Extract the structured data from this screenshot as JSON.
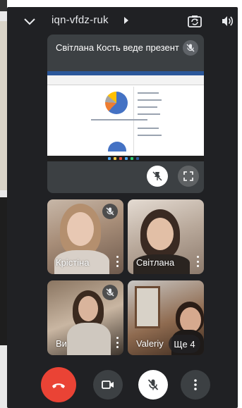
{
  "header": {
    "meeting_code": "iqn-vfdz-ruk",
    "icons": [
      "chevron-down-icon",
      "meeting-details-arrow-icon",
      "switch-camera-icon",
      "speaker-icon"
    ]
  },
  "presentation": {
    "title": "Світлана Кость веде презента",
    "mic_status": "muted"
  },
  "participants": [
    {
      "name": "Крістіна",
      "mic_status": "muted"
    },
    {
      "name": "Світлана",
      "mic_status": "on"
    },
    {
      "name": "Ви",
      "mic_status": "muted"
    },
    {
      "name": "Valeriy",
      "mic_status": "on"
    }
  ],
  "more_participants_label": "Ще 4",
  "controls": {
    "icons": [
      "end-call-icon",
      "camera-icon",
      "mic-off-icon",
      "more-options-icon"
    ],
    "colors": {
      "end_call": "#ea4335",
      "background": "#202124",
      "tile": "#3c4043"
    }
  }
}
